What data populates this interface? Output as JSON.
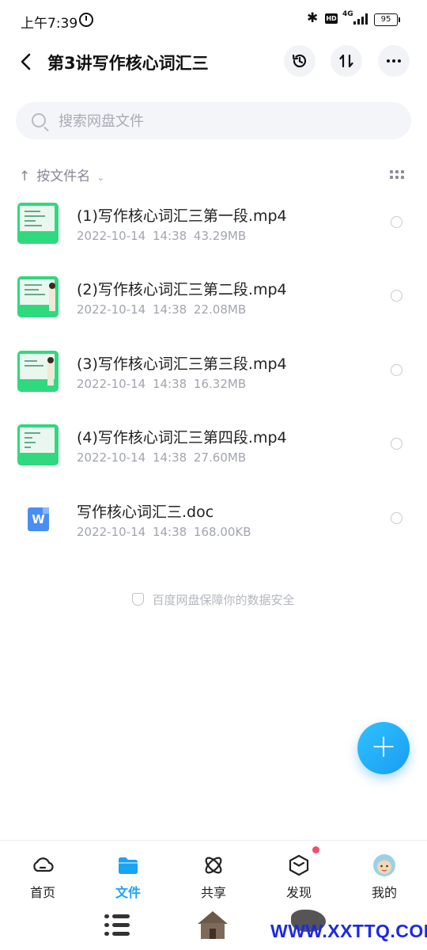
{
  "status_bar": {
    "time": "上午7:39",
    "hd": "HD",
    "network": "4G",
    "battery": "95"
  },
  "header": {
    "title": "第3讲写作核心词汇三"
  },
  "search": {
    "placeholder": "搜索网盘文件"
  },
  "sort": {
    "label": "按文件名"
  },
  "files": [
    {
      "name": "(1)写作核心词汇三第一段.mp4",
      "meta": "2022-10-14 14:38 43.29MB",
      "type": "video"
    },
    {
      "name": "(2)写作核心词汇三第二段.mp4",
      "meta": "2022-10-14 14:38 22.08MB",
      "type": "video"
    },
    {
      "name": "(3)写作核心词汇三第三段.mp4",
      "meta": "2022-10-14 14:38 16.32MB",
      "type": "video"
    },
    {
      "name": "(4)写作核心词汇三第四段.mp4",
      "meta": "2022-10-14 14:38 27.60MB",
      "type": "video"
    },
    {
      "name": "写作核心词汇三.doc",
      "meta": "2022-10-14 14:38 168.00KB",
      "type": "doc",
      "icon_letter": "W"
    }
  ],
  "safety_note": "百度网盘保障你的数据安全",
  "fab": {
    "symbol": "+"
  },
  "bottom_nav": [
    {
      "label": "首页",
      "active": false
    },
    {
      "label": "文件",
      "active": true
    },
    {
      "label": "共享",
      "active": false
    },
    {
      "label": "发现",
      "active": false,
      "badge": true
    },
    {
      "label": "我的",
      "active": false
    }
  ],
  "watermark": {
    "text": "WWW.XXTTQ.COM"
  },
  "colors": {
    "accent": "#1aa3f5",
    "badge": "#f54a6b",
    "watermark": "#1d28e8"
  }
}
